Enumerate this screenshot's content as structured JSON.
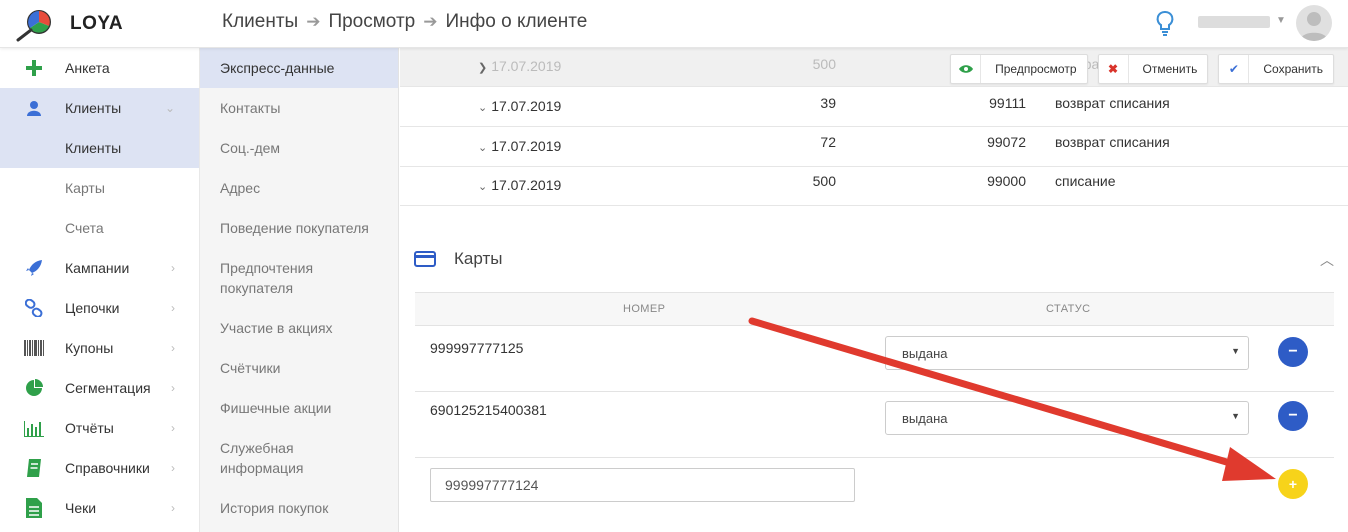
{
  "app": {
    "logo_text": "LOYA"
  },
  "breadcrumb": [
    "Клиенты",
    "Просмотр",
    "Инфо о клиенте"
  ],
  "sidebar": {
    "items": [
      {
        "label": "Анкета",
        "icon": "plus-icon"
      },
      {
        "label": "Клиенты",
        "icon": "user-icon"
      },
      {
        "label": "Клиенты",
        "sub": true
      },
      {
        "label": "Карты",
        "sub": true
      },
      {
        "label": "Счета",
        "sub": true
      },
      {
        "label": "Кампании",
        "icon": "rocket-icon"
      },
      {
        "label": "Цепочки",
        "icon": "chain-icon"
      },
      {
        "label": "Купоны",
        "icon": "barcode-icon"
      },
      {
        "label": "Сегментация",
        "icon": "pie-icon"
      },
      {
        "label": "Отчёты",
        "icon": "bar-chart-icon"
      },
      {
        "label": "Справочники",
        "icon": "book-icon"
      },
      {
        "label": "Чеки",
        "icon": "receipt-icon"
      }
    ]
  },
  "subnav": {
    "items": [
      "Экспресс-данные",
      "Контакты",
      "Соц.-дем",
      "Адрес",
      "Поведение покупателя",
      "Предпочтения покупателя",
      "Участие в акциях",
      "Счётчики",
      "Фишечные акции",
      "Служебная информация",
      "История покупок"
    ]
  },
  "toolbar": {
    "preview_label": "Предпросмотр",
    "cancel_label": "Отменить",
    "save_label": "Сохранить"
  },
  "transactions": [
    {
      "date": "17.07.2019",
      "amount": "500",
      "balance": "",
      "type": "возврат списания"
    },
    {
      "date": "17.07.2019",
      "amount": "39",
      "balance": "99111",
      "type": "возврат списания"
    },
    {
      "date": "17.07.2019",
      "amount": "72",
      "balance": "99072",
      "type": "возврат списания"
    },
    {
      "date": "17.07.2019",
      "amount": "500",
      "balance": "99000",
      "type": "списание"
    }
  ],
  "cards": {
    "title": "Карты",
    "col_number": "НОМЕР",
    "col_status": "СТАТУС",
    "rows": [
      {
        "number": "999997777125",
        "status": "выдана"
      },
      {
        "number": "690125215400381",
        "status": "выдана"
      }
    ],
    "new_card_value": "999997777124"
  },
  "colors": {
    "accent_blue": "#2e5cc6",
    "add_yellow": "#f7d31a",
    "active_bg": "#dde3f3",
    "arrow_red": "#e03a2e",
    "icon_green": "#2fa04a"
  }
}
